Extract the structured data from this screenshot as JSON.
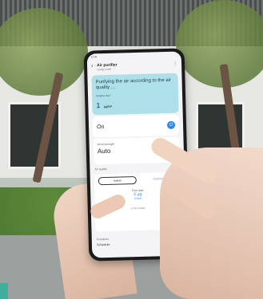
{
  "status_bar": {
    "time": "12:45"
  },
  "app": {
    "title": "Air purifier",
    "subtitle": "Living room"
  },
  "hero": {
    "text": "Purifying the air according to the air quality ...",
    "label": "Ultrafine dust",
    "value": "1",
    "unit": "µg/m³"
  },
  "power": {
    "label": "On"
  },
  "wind": {
    "label": "Wind strength",
    "value": "Auto"
  },
  "air_quality": {
    "section_label": "Air quality",
    "tabs": [
      "Indoor",
      "Outdoor"
    ],
    "fine_dust_label": "Fine dust",
    "fine_dust_value": "5 µg",
    "fine_dust_status": "Good",
    "updated": "11:40 Update"
  },
  "menu": {
    "section_label": "Functions",
    "items": [
      "Schedule"
    ]
  }
}
